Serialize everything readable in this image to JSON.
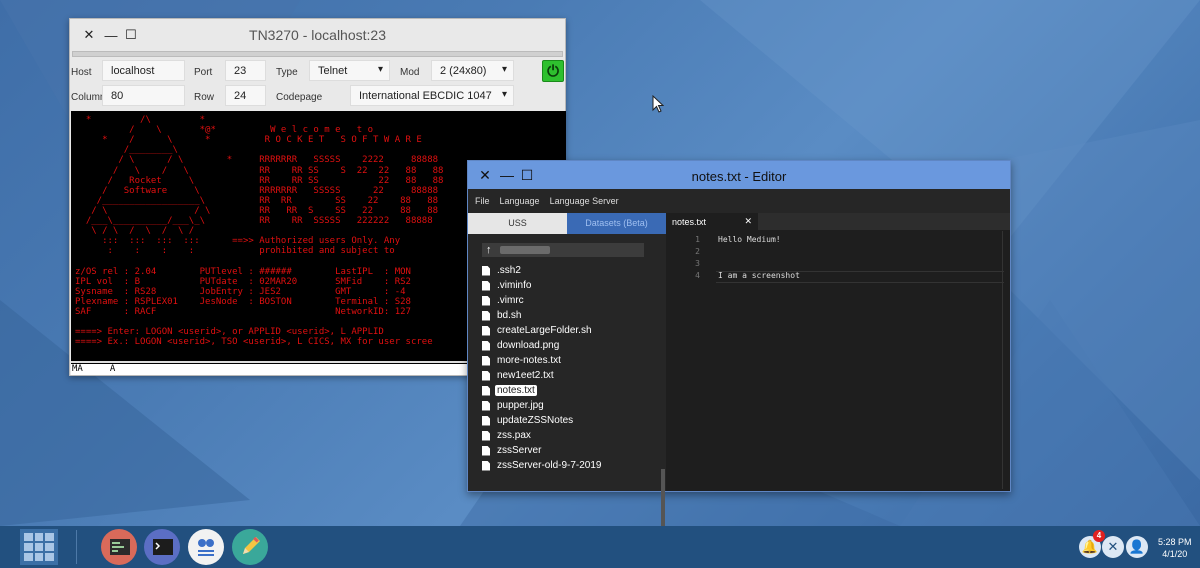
{
  "tn3270": {
    "title": "TN3270 - localhost:23",
    "host_label": "Host",
    "host_value": "localhost",
    "port_label": "Port",
    "port_value": "23",
    "type_label": "Type",
    "type_value": "Telnet",
    "mod_label": "Mod",
    "mod_value": "2 (24x80)",
    "column_label": "Column",
    "column_value": "80",
    "row_label": "Row",
    "row_value": "24",
    "codepage_label": "Codepage",
    "codepage_value": "International EBCDIC 1047",
    "terminal_lines": [
      "  *         /\\         *",
      "          /    \\       *@*          W e l c o m e   t o",
      "     *    /      \\      *          R O C K E T   S O F T W A R E",
      "         /________\\",
      "        / \\      / \\        *     RRRRRRR   SSSSS    2222     88888",
      "       /   \\    /   \\             RR    RR SS    S  22  22   88   88",
      "      /   Rocket     \\            RR    RR SS           22   88   88",
      "     /   Software     \\           RRRRRRR   SSSSS      22     88888",
      "    /__________________\\          RR  RR        SS    22    88   88",
      "   / \\                / \\         RR   RR  S    SS   22     88   88",
      "  /___\\__________/___\\_\\          RR    RR  SSSSS   222222   88888",
      "   \\ / \\  /  \\  /  \\ /",
      "     :::  :::  :::  :::      ==>> Authorized users Only. Any",
      "      :    :    :    :            prohibited and subject to",
      "",
      "z/OS rel : 2.04        PUTlevel : ######        LastIPL  : MON",
      "IPL vol  : B           PUTdate  : 02MAR20       SMFid    : RS2",
      "Sysname  : RS28        JobEntry : JES2          GMT      : -4",
      "Plexname : RSPLEX01    JesNode  : BOSTON        Terminal : S28",
      "SAF      : RACF                                 NetworkID: 127",
      "",
      "====> Enter: LOGON <userid>, or APPLID <userid>, L APPLID",
      "====> Ex.: LOGON <userid>, TSO <userid>, L CICS, MX for user scree"
    ],
    "status_line": "MA     A"
  },
  "editor": {
    "title": "notes.txt - Editor",
    "menu": [
      "File",
      "Language",
      "Language Server"
    ],
    "tab_uss": "USS",
    "tab_datasets": "Datasets (Beta)",
    "path_arrow": "🡑",
    "files": [
      ".ssh2",
      ".viminfo",
      ".vimrc",
      "bd.sh",
      "createLargeFolder.sh",
      "download.png",
      "more-notes.txt",
      "new1eet2.txt",
      "notes.txt",
      "pupper.jpg",
      "updateZSSNotes",
      "zss.pax",
      "zssServer",
      "zssServer-old-9-7-2019"
    ],
    "selected_file": "notes.txt",
    "open_tab": "notes.txt",
    "close_glyph": "✕",
    "line_numbers": [
      "1",
      "2",
      "3",
      "4"
    ],
    "code_lines": [
      "Hello Medium!",
      "",
      "",
      "I am a screenshot"
    ]
  },
  "taskbar": {
    "notification_count": "4",
    "time": "5:28 PM",
    "date": "4/1/20"
  },
  "icons": {
    "close": "✕",
    "minimize": "—",
    "maximize": "☐",
    "power": "⏻"
  }
}
